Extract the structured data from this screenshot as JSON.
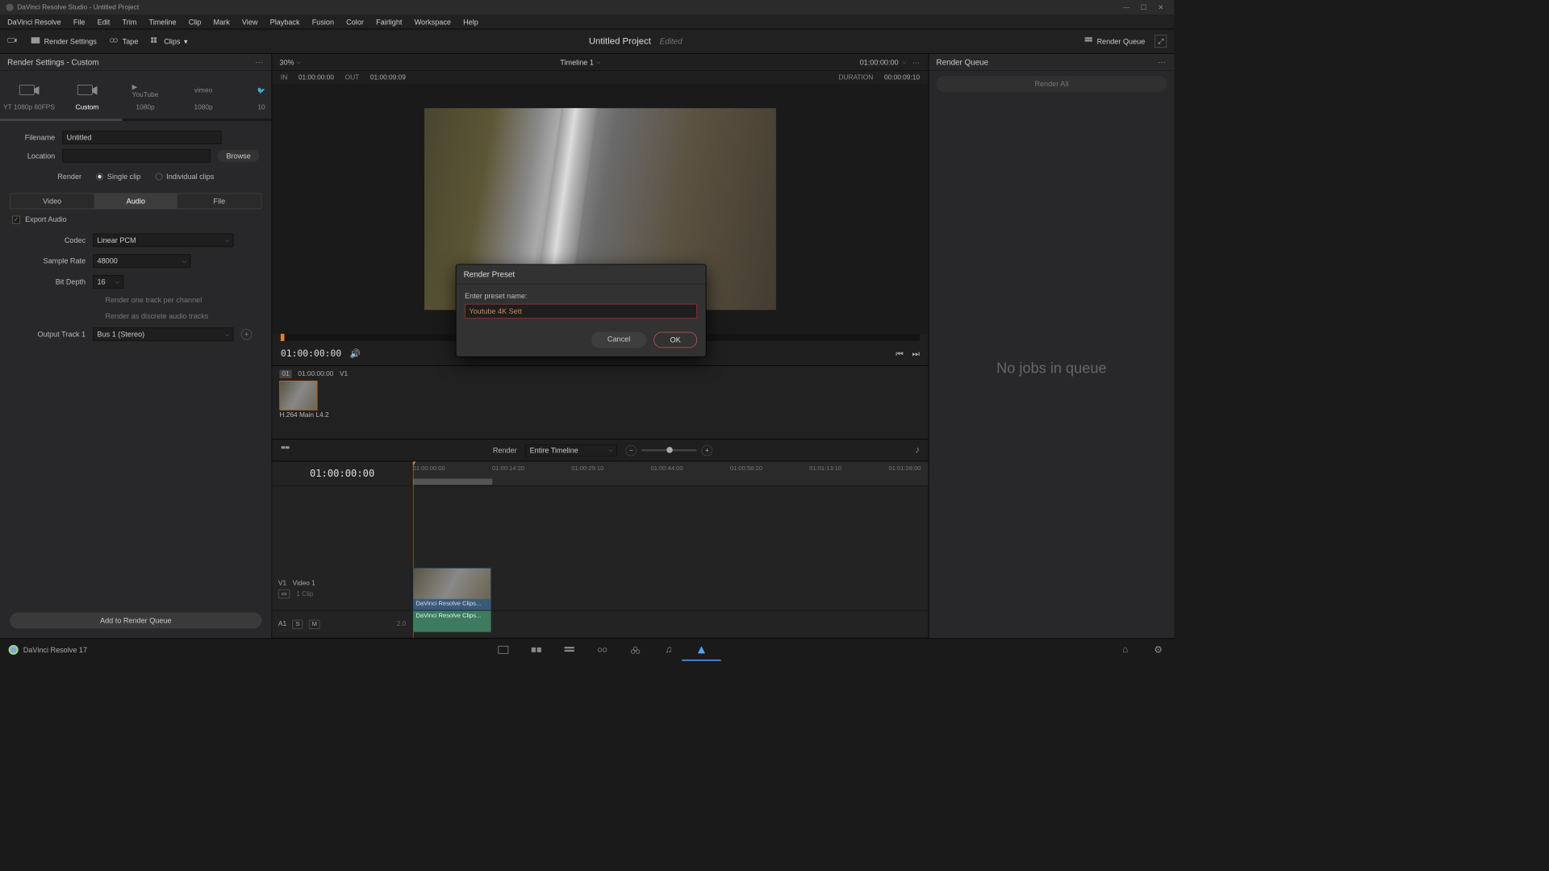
{
  "titlebar": {
    "text": "DaVinci Resolve Studio - Untitled Project"
  },
  "menubar": [
    "DaVinci Resolve",
    "File",
    "Edit",
    "Trim",
    "Timeline",
    "Clip",
    "Mark",
    "View",
    "Playback",
    "Fusion",
    "Color",
    "Fairlight",
    "Workspace",
    "Help"
  ],
  "toptoolbar": {
    "render_settings": "Render Settings",
    "tape": "Tape",
    "clips": "Clips",
    "project_title": "Untitled Project",
    "edited": "Edited",
    "render_queue": "Render Queue"
  },
  "left": {
    "header": "Render Settings - Custom",
    "presets": [
      {
        "label": "YT 1080p 60FPS",
        "icon": "custom"
      },
      {
        "label": "Custom",
        "icon": "custom",
        "active": true
      },
      {
        "label": "1080p",
        "icon": "youtube"
      },
      {
        "label": "1080p",
        "icon": "vimeo"
      },
      {
        "label": "10",
        "icon": "twitter"
      }
    ],
    "filename_label": "Filename",
    "filename_value": "Untitled",
    "location_label": "Location",
    "location_value": "",
    "browse": "Browse",
    "render_label": "Render",
    "single_clip": "Single clip",
    "individual_clips": "Individual clips",
    "tabs": {
      "video": "Video",
      "audio": "Audio",
      "file": "File",
      "active": "audio"
    },
    "export_audio": "Export Audio",
    "codec_label": "Codec",
    "codec_value": "Linear PCM",
    "samplerate_label": "Sample Rate",
    "samplerate_value": "48000",
    "bitdepth_label": "Bit Depth",
    "bitdepth_value": "16",
    "render_one_track": "Render one track per channel",
    "render_discrete": "Render as discrete audio tracks",
    "output_track_label": "Output Track 1",
    "output_track_value": "Bus 1 (Stereo)",
    "add_to_queue": "Add to Render Queue"
  },
  "center": {
    "zoom": "30%",
    "timeline_name": "Timeline 1",
    "tc_header": "01:00:00:00",
    "in_label": "IN",
    "in_tc": "01:00:00:00",
    "out_label": "OUT",
    "out_tc": "01:00:09:09",
    "duration_label": "DURATION",
    "duration_tc": "00:00:09:10",
    "playback_tc": "01:00:00:00",
    "clip_hdr_n": "01",
    "clip_hdr_tc": "01:00:00:00",
    "clip_hdr_track": "V1",
    "clip_name": "H.264 Main L4.2",
    "render_label": "Render",
    "render_scope": "Entire Timeline",
    "timeline_tc_big": "01:00:00:00",
    "ruler_ticks": [
      "01:00:00:00",
      "01:00:14:20",
      "01:00:29:10",
      "01:00:44:00",
      "01:00:58:20",
      "01:01:13:10",
      "01:01:28:00"
    ],
    "track_v1": "V1",
    "track_v1_name": "Video 1",
    "track_v1_count": "1 Clip",
    "track_a1": "A1",
    "track_a1_ch": "2.0",
    "vclip_label": "DaVinci Resolve Clips...",
    "aclip_label": "DaVinci Resolve Clips..."
  },
  "right": {
    "header": "Render Queue",
    "empty": "No jobs in queue",
    "render_all": "Render All"
  },
  "modal": {
    "title": "Render Preset",
    "label": "Enter preset name:",
    "value": "Youtube 4K Sett",
    "cancel": "Cancel",
    "ok": "OK"
  },
  "bottombar": {
    "version": "DaVinci Resolve 17"
  }
}
